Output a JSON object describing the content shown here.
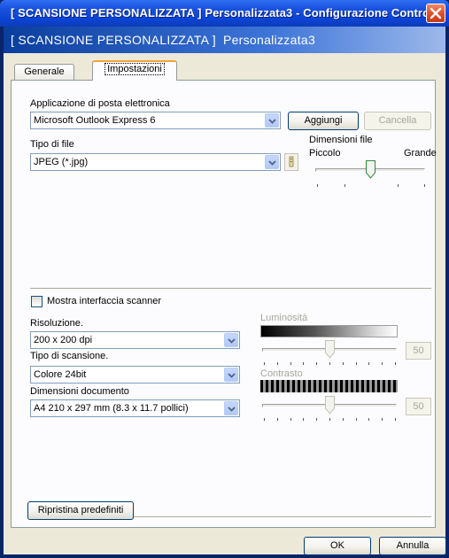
{
  "window": {
    "title": "[ SCANSIONE PERSONALIZZATA ]  Personalizzata3 - Configurazione Contro...",
    "header_part1": "[ SCANSIONE PERSONALIZZATA ]",
    "header_part2": "Personalizzata3"
  },
  "tabs": [
    {
      "label": "Generale",
      "active": false
    },
    {
      "label": "Impostazioni",
      "active": true
    }
  ],
  "email": {
    "label": "Applicazione di posta elettronica",
    "value": "Microsoft Outlook Express 6",
    "add_button": "Aggiungi",
    "delete_button": "Cancella"
  },
  "file_type": {
    "label": "Tipo di file",
    "value": "JPEG (*.jpg)"
  },
  "file_size": {
    "label": "Dimensioni file",
    "min_label": "Piccolo",
    "max_label": "Grande",
    "level": 0.5
  },
  "scanner": {
    "show_interface_label": "Mostra interfaccia scanner",
    "show_interface_checked": false,
    "resolution_label": "Risoluzione.",
    "resolution_value": "200 x 200 dpi",
    "scan_type_label": "Tipo di scansione.",
    "scan_type_value": "Colore 24bit",
    "doc_size_label": "Dimensioni documento",
    "doc_size_value": "A4 210 x 297 mm (8.3 x 11.7 pollici)"
  },
  "brightness": {
    "label": "Luminosità",
    "value": "50",
    "level": 0.5
  },
  "contrast": {
    "label": "Contrasto",
    "value": "50",
    "level": 0.5
  },
  "buttons": {
    "restore_defaults": "Ripristina predefiniti",
    "ok": "OK",
    "cancel": "Annulla"
  },
  "colors": {
    "titlebar": "#0A44D6",
    "close": "#E2502B",
    "dialog_bg": "#ECE9D8",
    "tab_highlight": "#F1A637"
  }
}
